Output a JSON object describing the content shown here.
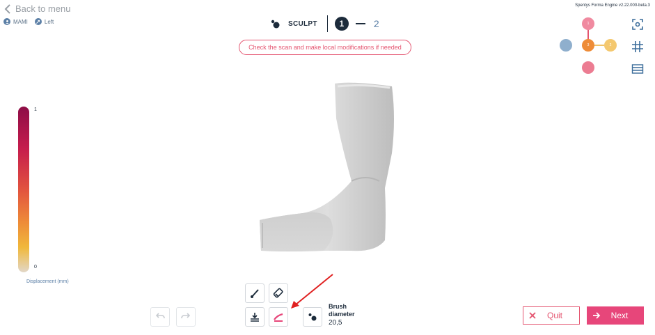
{
  "nav": {
    "back_label": "Back to menu"
  },
  "patient": {
    "name": "MAMI",
    "side": "Left"
  },
  "header": {
    "step_title": "SCULPT",
    "step_current": "1",
    "step_next": "2"
  },
  "hint": "Check the scan and make local modifications if needed",
  "version": "Spentys Forma Engine v2.22.000-beta.3",
  "orientation": {
    "nodes": [
      "1",
      "3",
      "2"
    ]
  },
  "colorbar": {
    "max": "1",
    "min": "0",
    "label": "Displacement (mm)"
  },
  "brush": {
    "label": "Brush diameter",
    "value": "20,5"
  },
  "actions": {
    "quit": "Quit",
    "next": "Next"
  },
  "colors": {
    "accent": "#e7467a",
    "dark": "#1c2b3b",
    "muted": "#5b7fa6"
  }
}
